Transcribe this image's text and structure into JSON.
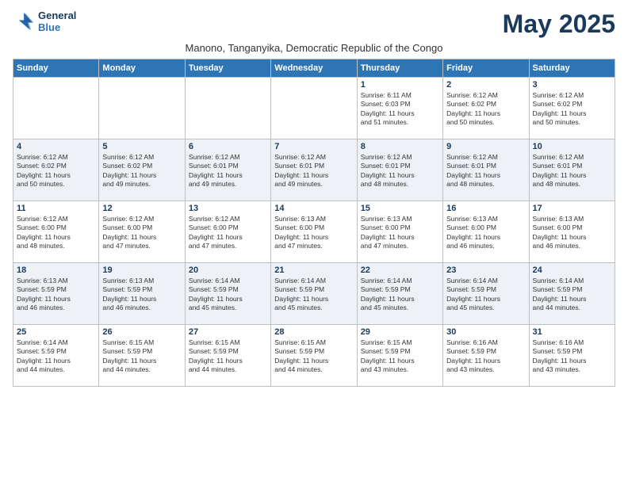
{
  "logo": {
    "line1": "General",
    "line2": "Blue"
  },
  "title": "May 2025",
  "subtitle": "Manono, Tanganyika, Democratic Republic of the Congo",
  "days_of_week": [
    "Sunday",
    "Monday",
    "Tuesday",
    "Wednesday",
    "Thursday",
    "Friday",
    "Saturday"
  ],
  "weeks": [
    [
      {
        "day": "",
        "info": ""
      },
      {
        "day": "",
        "info": ""
      },
      {
        "day": "",
        "info": ""
      },
      {
        "day": "",
        "info": ""
      },
      {
        "day": "1",
        "info": "Sunrise: 6:11 AM\nSunset: 6:03 PM\nDaylight: 11 hours\nand 51 minutes."
      },
      {
        "day": "2",
        "info": "Sunrise: 6:12 AM\nSunset: 6:02 PM\nDaylight: 11 hours\nand 50 minutes."
      },
      {
        "day": "3",
        "info": "Sunrise: 6:12 AM\nSunset: 6:02 PM\nDaylight: 11 hours\nand 50 minutes."
      }
    ],
    [
      {
        "day": "4",
        "info": "Sunrise: 6:12 AM\nSunset: 6:02 PM\nDaylight: 11 hours\nand 50 minutes."
      },
      {
        "day": "5",
        "info": "Sunrise: 6:12 AM\nSunset: 6:02 PM\nDaylight: 11 hours\nand 49 minutes."
      },
      {
        "day": "6",
        "info": "Sunrise: 6:12 AM\nSunset: 6:01 PM\nDaylight: 11 hours\nand 49 minutes."
      },
      {
        "day": "7",
        "info": "Sunrise: 6:12 AM\nSunset: 6:01 PM\nDaylight: 11 hours\nand 49 minutes."
      },
      {
        "day": "8",
        "info": "Sunrise: 6:12 AM\nSunset: 6:01 PM\nDaylight: 11 hours\nand 48 minutes."
      },
      {
        "day": "9",
        "info": "Sunrise: 6:12 AM\nSunset: 6:01 PM\nDaylight: 11 hours\nand 48 minutes."
      },
      {
        "day": "10",
        "info": "Sunrise: 6:12 AM\nSunset: 6:01 PM\nDaylight: 11 hours\nand 48 minutes."
      }
    ],
    [
      {
        "day": "11",
        "info": "Sunrise: 6:12 AM\nSunset: 6:00 PM\nDaylight: 11 hours\nand 48 minutes."
      },
      {
        "day": "12",
        "info": "Sunrise: 6:12 AM\nSunset: 6:00 PM\nDaylight: 11 hours\nand 47 minutes."
      },
      {
        "day": "13",
        "info": "Sunrise: 6:12 AM\nSunset: 6:00 PM\nDaylight: 11 hours\nand 47 minutes."
      },
      {
        "day": "14",
        "info": "Sunrise: 6:13 AM\nSunset: 6:00 PM\nDaylight: 11 hours\nand 47 minutes."
      },
      {
        "day": "15",
        "info": "Sunrise: 6:13 AM\nSunset: 6:00 PM\nDaylight: 11 hours\nand 47 minutes."
      },
      {
        "day": "16",
        "info": "Sunrise: 6:13 AM\nSunset: 6:00 PM\nDaylight: 11 hours\nand 46 minutes."
      },
      {
        "day": "17",
        "info": "Sunrise: 6:13 AM\nSunset: 6:00 PM\nDaylight: 11 hours\nand 46 minutes."
      }
    ],
    [
      {
        "day": "18",
        "info": "Sunrise: 6:13 AM\nSunset: 5:59 PM\nDaylight: 11 hours\nand 46 minutes."
      },
      {
        "day": "19",
        "info": "Sunrise: 6:13 AM\nSunset: 5:59 PM\nDaylight: 11 hours\nand 46 minutes."
      },
      {
        "day": "20",
        "info": "Sunrise: 6:14 AM\nSunset: 5:59 PM\nDaylight: 11 hours\nand 45 minutes."
      },
      {
        "day": "21",
        "info": "Sunrise: 6:14 AM\nSunset: 5:59 PM\nDaylight: 11 hours\nand 45 minutes."
      },
      {
        "day": "22",
        "info": "Sunrise: 6:14 AM\nSunset: 5:59 PM\nDaylight: 11 hours\nand 45 minutes."
      },
      {
        "day": "23",
        "info": "Sunrise: 6:14 AM\nSunset: 5:59 PM\nDaylight: 11 hours\nand 45 minutes."
      },
      {
        "day": "24",
        "info": "Sunrise: 6:14 AM\nSunset: 5:59 PM\nDaylight: 11 hours\nand 44 minutes."
      }
    ],
    [
      {
        "day": "25",
        "info": "Sunrise: 6:14 AM\nSunset: 5:59 PM\nDaylight: 11 hours\nand 44 minutes."
      },
      {
        "day": "26",
        "info": "Sunrise: 6:15 AM\nSunset: 5:59 PM\nDaylight: 11 hours\nand 44 minutes."
      },
      {
        "day": "27",
        "info": "Sunrise: 6:15 AM\nSunset: 5:59 PM\nDaylight: 11 hours\nand 44 minutes."
      },
      {
        "day": "28",
        "info": "Sunrise: 6:15 AM\nSunset: 5:59 PM\nDaylight: 11 hours\nand 44 minutes."
      },
      {
        "day": "29",
        "info": "Sunrise: 6:15 AM\nSunset: 5:59 PM\nDaylight: 11 hours\nand 43 minutes."
      },
      {
        "day": "30",
        "info": "Sunrise: 6:16 AM\nSunset: 5:59 PM\nDaylight: 11 hours\nand 43 minutes."
      },
      {
        "day": "31",
        "info": "Sunrise: 6:16 AM\nSunset: 5:59 PM\nDaylight: 11 hours\nand 43 minutes."
      }
    ]
  ]
}
